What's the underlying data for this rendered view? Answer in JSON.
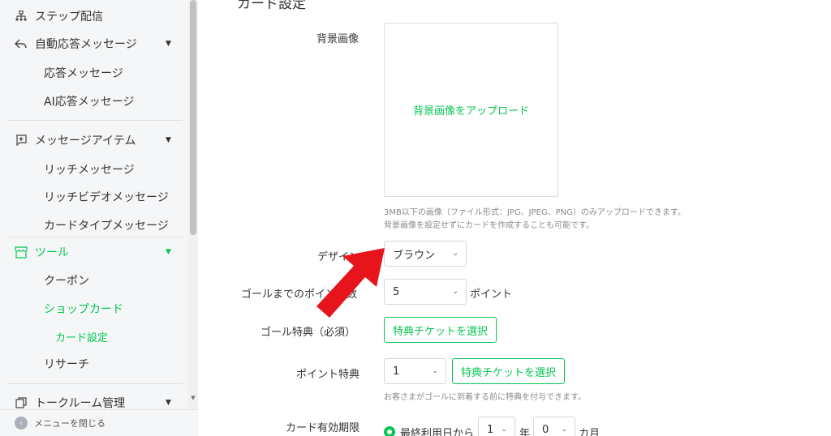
{
  "sidebar": {
    "items": [
      {
        "label": "ステップ配信",
        "icon": "hierarchy-icon"
      },
      {
        "label": "自動応答メッセージ",
        "icon": "reply-icon"
      },
      {
        "label": "メッセージアイテム",
        "icon": "add-message-icon"
      },
      {
        "label": "ツール",
        "icon": "shop-icon"
      },
      {
        "label": "トークルーム管理",
        "icon": "talk-room-icon"
      }
    ],
    "sub_auto": [
      "応答メッセージ",
      "AI応答メッセージ"
    ],
    "sub_message": [
      "リッチメッセージ",
      "リッチビデオメッセージ",
      "カードタイプメッセージ"
    ],
    "sub_tools": [
      "クーポン",
      "ショップカード",
      "リサーチ"
    ],
    "sub_card": "カード設定",
    "close_menu": "メニューを閉じる"
  },
  "main": {
    "heading": "カード設定",
    "background_label": "背景画像",
    "upload_link": "背景画像をアップロード",
    "help_line1": "3MB以下の画像（ファイル形式：JPG、JPEG、PNG）のみアップロードできます。",
    "help_line2": "背景画像を設定せずにカードを作成することも可能です。",
    "design_label": "デザイン",
    "design_value": "ブラウン",
    "goal_points_label": "ゴールまでのポイント数",
    "goal_points_value": "5",
    "points_unit": "ポイント",
    "goal_reward_label": "ゴール特典（必須）",
    "select_ticket": "特典チケットを選択",
    "point_reward_label": "ポイント特典",
    "point_reward_value": "1",
    "point_reward_help": "お客さまがゴールに到着する前に特典を付与できます。",
    "expiry_label": "カード有効期限",
    "expiry_option": "最終利用日から",
    "year_value": "1",
    "year_unit": "年",
    "month_value": "0",
    "month_unit": "カ月"
  },
  "colors": {
    "accent": "#06c755",
    "arrow": "#e8141c"
  }
}
